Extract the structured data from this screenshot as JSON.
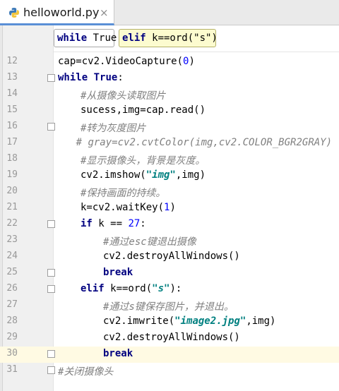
{
  "tab": {
    "title": "helloworld.py",
    "close": "×",
    "icon": "python-file-icon"
  },
  "breadcrumbs": [
    {
      "kw": "while",
      "rest": " True"
    },
    {
      "kw": "elif",
      "rest": " k==ord(\"s\")"
    }
  ],
  "editor": {
    "current_line": "30",
    "lines": [
      {
        "n": "12",
        "t": "cap=cv2.VideoCapture(0)"
      },
      {
        "n": "13",
        "t": "while True:"
      },
      {
        "n": "14",
        "t": "#从摄像头读取图片"
      },
      {
        "n": "15",
        "t": "sucess,img=cap.read()"
      },
      {
        "n": "16",
        "t": "#转为灰度图片"
      },
      {
        "n": "17",
        "t": "# gray=cv2.cvtColor(img,cv2.COLOR_BGR2GRAY)"
      },
      {
        "n": "18",
        "t": "#显示摄像头，背景是灰度。"
      },
      {
        "n": "19",
        "t": "cv2.imshow(\"img\",img)"
      },
      {
        "n": "20",
        "t": "#保持画面的持续。"
      },
      {
        "n": "21",
        "t": "k=cv2.waitKey(1)"
      },
      {
        "n": "22",
        "t": "if k == 27:"
      },
      {
        "n": "23",
        "t": "#通过esc键退出摄像"
      },
      {
        "n": "24",
        "t": "cv2.destroyAllWindows()"
      },
      {
        "n": "25",
        "t": "break"
      },
      {
        "n": "26",
        "t": "elif k==ord(\"s\"):"
      },
      {
        "n": "27",
        "t": "#通过s键保存图片，并退出。"
      },
      {
        "n": "28",
        "t": "cv2.imwrite(\"image2.jpg\",img)"
      },
      {
        "n": "29",
        "t": "cv2.destroyAllWindows()"
      },
      {
        "n": "30",
        "t": "break"
      },
      {
        "n": "31",
        "t": "#关闭摄像头"
      }
    ]
  }
}
